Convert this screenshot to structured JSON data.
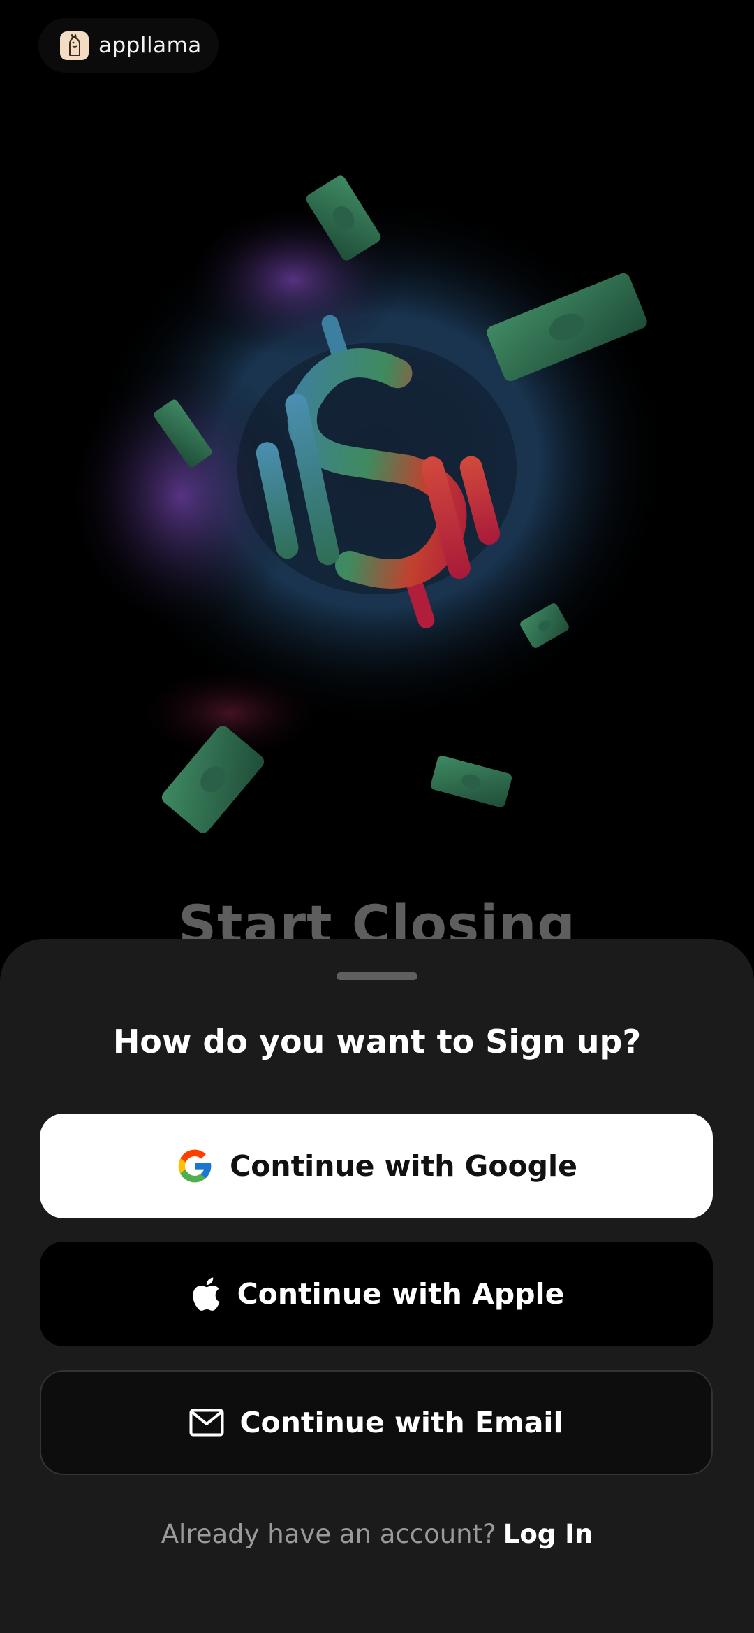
{
  "brand": {
    "logo_text": "appllama"
  },
  "hero": {
    "headline": "Start Closing"
  },
  "signup_sheet": {
    "title": "How do you want to Sign up?",
    "buttons": {
      "google": {
        "label": "Continue with Google",
        "icon": "google-icon"
      },
      "apple": {
        "label": "Continue with Apple",
        "icon": "apple-icon"
      },
      "email": {
        "label": "Continue with Email",
        "icon": "mail-icon"
      }
    },
    "footer": {
      "prompt": "Already have an account?",
      "link": "Log In"
    }
  },
  "colors": {
    "background": "#000000",
    "sheet": "#1b1b1b",
    "google_button": "#ffffff",
    "apple_button": "#000000",
    "email_button": "#0d0d0d",
    "muted_text": "#9a9a9a",
    "money_green": "#2f6b4f"
  }
}
